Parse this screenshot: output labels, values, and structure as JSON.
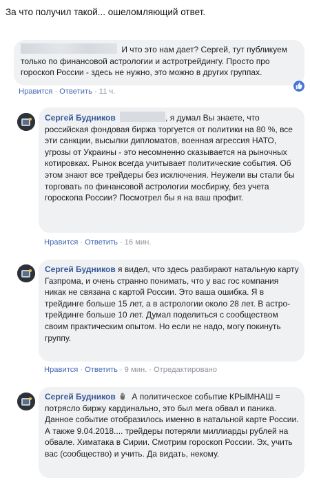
{
  "caption": "За что получил такой... ошеломляющий ответ.",
  "comments": [
    {
      "text": "И что это нам дает? Сергей, тут публикуем только по финансовой астрологии и астротрейдингу. Просто про гороскоп России - здесь не нужно, это можно в других группах.",
      "like_label": "Нравится",
      "reply_label": "Ответить",
      "time": "11 ч."
    },
    {
      "author": "Сергей Будников",
      "text": ", я думал Вы знаете, что российская фондовая биржа торгуется от политики на 80 %, все эти санкции, высылки дипломатов, военная агрессия НАТО, угрозы от Украины - это несомненно сказывается на рыночных котировках. Рынок всегда учитывает политические события. Об этом знают все трейдеры без исключения. Неужели вы стали бы торговать по финансовой астрологии мосбиржу, без учета гороскопа России? Посмотрел бы я на ваш профит.",
      "like_label": "Нравится",
      "reply_label": "Ответить",
      "time": "16 мин."
    },
    {
      "author": "Сергей Будников",
      "text": "я видел, что здесь разбирают натальную карту Газпрома, и очень странно понимать, что у вас гос компания никак не связана с картой России. Это ваша ошибка. Я в трейдинге больше 15 лет, а в астрологии около 28 лет. В астро-трейдинге больше 10 лет. Думал поделиться с сообществом своим практическим опытом. Но если не надо, могу покинуть группу.",
      "like_label": "Нравится",
      "reply_label": "Ответить",
      "time": "9 мин.",
      "edited": "Отредактировано"
    },
    {
      "author": "Сергей Будников",
      "text": "А политическое событие КРЫМНАШ = потрясло биржу кардинально, это был мега обвал и паника. Данное событие отобразилось именно в натальной карте России. А также 9.04.2018.... трейдеры потеряли миллиарды рублей на обвале. Химатака в Сирии. Смотрим гороскоп России. Эх, учить вас (сообщество) и учить. Да видать, некому."
    }
  ]
}
